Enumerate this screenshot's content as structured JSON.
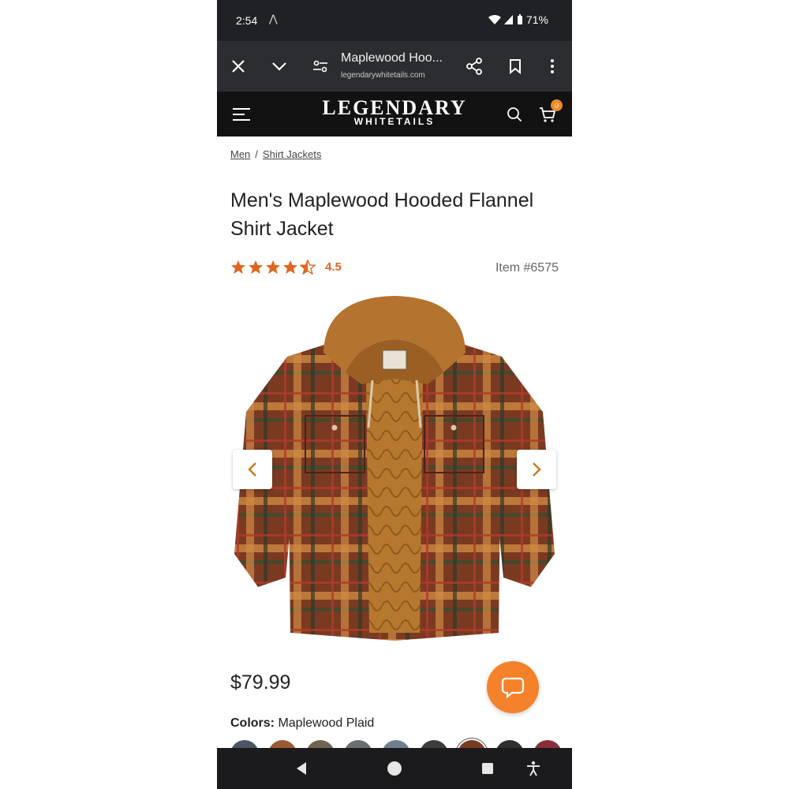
{
  "status_bar": {
    "time": "2:54",
    "extra": "⋀",
    "battery": "71%"
  },
  "browser": {
    "page_title": "Maplewood Hoo...",
    "url": "legendarywhitetails.com"
  },
  "site": {
    "logo_top": "LEGENDARY",
    "logo_bottom": "WHITETAILS",
    "cart_count": "0"
  },
  "breadcrumb": {
    "items": [
      "Men",
      "Shirt Jackets"
    ],
    "separator": "/"
  },
  "product": {
    "title": "Men's Maplewood Hooded Flannel Shirt Jacket",
    "rating": "4.5",
    "item_number": "Item #6575",
    "price": "$79.99",
    "colors_label": "Colors:",
    "color_value": "Maplewood Plaid"
  },
  "colors_accent": {
    "brand_orange": "#f5822a",
    "star_orange": "#e0651e"
  },
  "icons": [
    "close-icon",
    "chevron-down-icon",
    "site-settings-icon",
    "share-icon",
    "bookmark-icon",
    "more-icon",
    "menu-icon",
    "search-icon",
    "cart-icon",
    "chat-icon",
    "back-icon",
    "home-icon",
    "recents-icon",
    "accessibility-icon"
  ]
}
